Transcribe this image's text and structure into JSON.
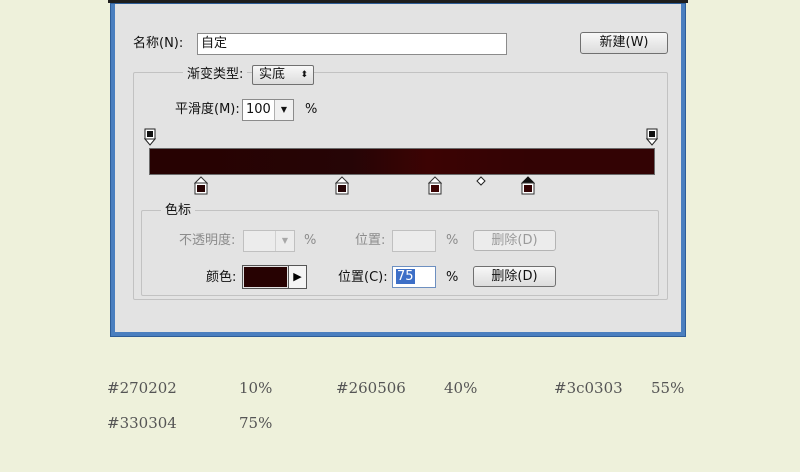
{
  "dialog": {
    "name_label": "名称(N):",
    "name_value": "自定",
    "new_button": "新建(W)",
    "gradient_type_label": "渐变类型:",
    "gradient_type_value": "实底",
    "smoothness_label": "平滑度(M):",
    "smoothness_value": "100",
    "smoothness_unit": "%",
    "color_stops_group": "色标",
    "opacity_label": "不透明度:",
    "opacity_unit": "%",
    "location_label_disabled": "位置:",
    "location_unit_disabled": "%",
    "delete_button_disabled": "删除(D)",
    "color_label": "颜色:",
    "color_swatch": "#270202",
    "location_label": "位置(C):",
    "location_value": "75",
    "location_unit": "%",
    "delete_button": "删除(D)"
  },
  "gradient_stops": [
    {
      "color": "#270202",
      "location": 10
    },
    {
      "color": "#260506",
      "location": 40
    },
    {
      "color": "#3c0303",
      "location": 55
    },
    {
      "color": "#330304",
      "location": 75
    }
  ],
  "notes": [
    {
      "hex": "#270202",
      "percent": "10%"
    },
    {
      "hex": "#260506",
      "percent": "40%"
    },
    {
      "hex": "#3c0303",
      "percent": "55%"
    },
    {
      "hex": "#330304",
      "percent": "75%"
    }
  ]
}
